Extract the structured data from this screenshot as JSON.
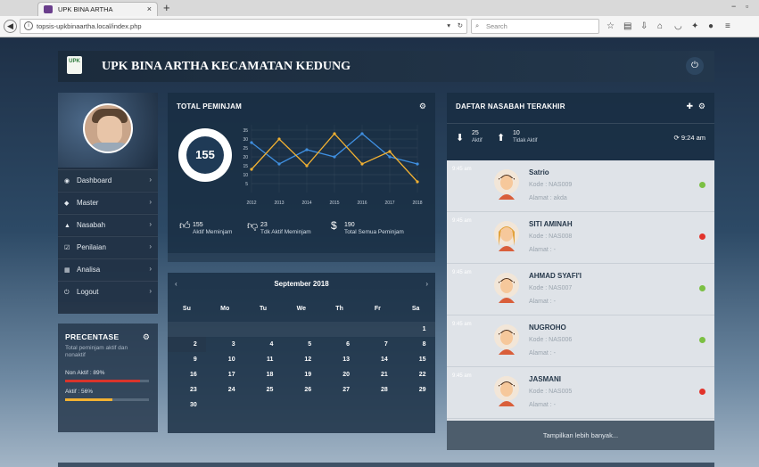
{
  "browser": {
    "tab_title": "UPK BINA ARTHA",
    "tab_close": "×",
    "new_tab": "+",
    "url": "topsis-upkbinaartha.local/index.php",
    "search_placeholder": "Search"
  },
  "header": {
    "logo_text": "UPK",
    "title": "UPK BINA ARTHA KECAMATAN KEDUNG"
  },
  "sidebar": {
    "items": [
      {
        "label": "Dashboard",
        "icon": "dashboard-icon"
      },
      {
        "label": "Master",
        "icon": "tag-icon"
      },
      {
        "label": "Nasabah",
        "icon": "user-icon"
      },
      {
        "label": "Penilaian",
        "icon": "edit-icon"
      },
      {
        "label": "Analisa",
        "icon": "table-icon"
      },
      {
        "label": "Logout",
        "icon": "power-icon"
      }
    ]
  },
  "percentage": {
    "title": "PRECENTASE",
    "subtitle": "Total peminjam aktif dan nonaktif",
    "non_aktif_label": "Non Aktif : 89%",
    "non_aktif_value": 89,
    "aktif_label": "Aktif : 56%",
    "aktif_value": 56,
    "colors": {
      "non_aktif": "#d9342b",
      "aktif": "#f2b132"
    }
  },
  "total_peminjam": {
    "title": "TOTAL PEMINJAM",
    "donut_value": "155",
    "stats": [
      {
        "value": "155",
        "label": "Aktif Meminjam"
      },
      {
        "value": "23",
        "label": "Tdk Aktif Meminjam"
      },
      {
        "value": "190",
        "label": "Total Semua Peminjam"
      }
    ]
  },
  "chart_data": {
    "type": "line",
    "x": [
      "2012",
      "2013",
      "2014",
      "2015",
      "2016",
      "2017",
      "2018"
    ],
    "y_ticks": [
      "5",
      "10",
      "15",
      "20",
      "25",
      "30",
      "35"
    ],
    "ylim": [
      0,
      38
    ],
    "series": [
      {
        "values": [
          28,
          16,
          24,
          20,
          33,
          20,
          16
        ],
        "color": "#3f8fe0"
      },
      {
        "values": [
          13,
          30,
          15,
          33,
          16,
          23,
          6
        ],
        "color": "#f2b132"
      }
    ]
  },
  "calendar": {
    "month": "September 2018",
    "prev": "‹",
    "next": "›",
    "days": [
      "Su",
      "Mo",
      "Tu",
      "We",
      "Th",
      "Fr",
      "Sa"
    ],
    "weeks": [
      [
        "",
        "",
        "",
        "",
        "",
        "",
        "1"
      ],
      [
        "2",
        "3",
        "4",
        "5",
        "6",
        "7",
        "8"
      ],
      [
        "9",
        "10",
        "11",
        "12",
        "13",
        "14",
        "15"
      ],
      [
        "16",
        "17",
        "18",
        "19",
        "20",
        "21",
        "22"
      ],
      [
        "23",
        "24",
        "25",
        "26",
        "27",
        "28",
        "29"
      ],
      [
        "30",
        "",
        "",
        "",
        "",
        "",
        ""
      ]
    ]
  },
  "nasabah": {
    "title": "DAFTAR NASABAH TERAKHIR",
    "aktif_count": "25",
    "aktif_label": "Aktif",
    "tidak_count": "10",
    "tidak_label": "Tidak Aktif",
    "time": "9:24 am",
    "entries": [
      {
        "time": "9:45 am",
        "name": "Satrio",
        "kode": "Kode : NAS009",
        "alamat": "Alamat : akda",
        "status": "#7bc043",
        "gender": "m"
      },
      {
        "time": "9:45 am",
        "name": "SITI AMINAH",
        "kode": "Kode : NAS008",
        "alamat": "Alamat : -",
        "status": "#e2332b",
        "gender": "f"
      },
      {
        "time": "9:45 am",
        "name": "AHMAD SYAFI'I",
        "kode": "Kode : NAS007",
        "alamat": "Alamat : -",
        "status": "#7bc043",
        "gender": "m"
      },
      {
        "time": "9:45 am",
        "name": "NUGROHO",
        "kode": "Kode : NAS006",
        "alamat": "Alamat : -",
        "status": "#7bc043",
        "gender": "m"
      },
      {
        "time": "9:45 am",
        "name": "JASMANI",
        "kode": "Kode : NAS005",
        "alamat": "Alamat : -",
        "status": "#e2332b",
        "gender": "m"
      }
    ],
    "more_label": "Tampilkan lebih banyak..."
  }
}
